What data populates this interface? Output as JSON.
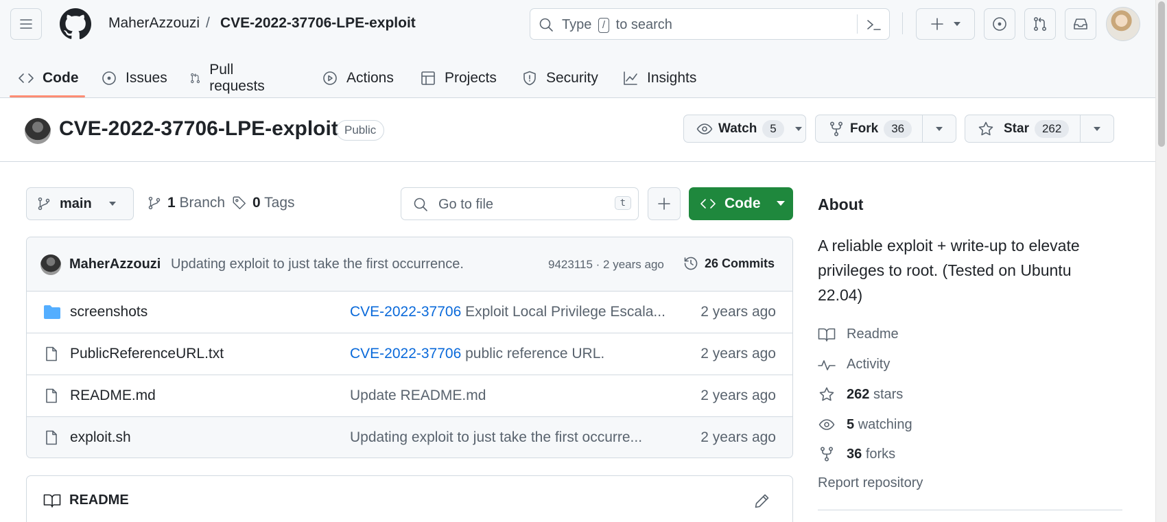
{
  "header": {
    "owner": "MaherAzzouzi",
    "separator": "/",
    "repo": "CVE-2022-37706-LPE-exploit",
    "search": {
      "prefix": "Type",
      "key": "/",
      "suffix": "to search"
    }
  },
  "tabs": [
    {
      "label": "Code",
      "icon": "code-icon",
      "active": true
    },
    {
      "label": "Issues",
      "icon": "issue-opened-icon"
    },
    {
      "label": "Pull requests",
      "icon": "git-pull-request-icon"
    },
    {
      "label": "Actions",
      "icon": "play-icon"
    },
    {
      "label": "Projects",
      "icon": "table-icon"
    },
    {
      "label": "Security",
      "icon": "shield-icon"
    },
    {
      "label": "Insights",
      "icon": "graph-icon"
    }
  ],
  "repo": {
    "name": "CVE-2022-37706-LPE-exploit",
    "visibility": "Public",
    "watch": {
      "label": "Watch",
      "count": "5"
    },
    "fork": {
      "label": "Fork",
      "count": "36"
    },
    "star": {
      "label": "Star",
      "count": "262"
    }
  },
  "toolbar": {
    "branch": "main",
    "branches_count": "1",
    "branches_label": "Branch",
    "tags_count": "0",
    "tags_label": "Tags",
    "goto_placeholder": "Go to file",
    "goto_key": "t",
    "code_label": "Code"
  },
  "latest_commit": {
    "author": "MaherAzzouzi",
    "message": "Updating exploit to just take the first occurrence.",
    "sha_age": "9423115 · 2 years ago",
    "commits_count": "26",
    "commits_label": "Commits"
  },
  "files": [
    {
      "name": "screenshots",
      "type": "dir",
      "msg_link": "CVE-2022-37706",
      "msg": " Exploit Local Privilege Escala...",
      "age": "2 years ago"
    },
    {
      "name": "PublicReferenceURL.txt",
      "type": "file",
      "msg_link": "CVE-2022-37706",
      "msg": " public reference URL.",
      "age": "2 years ago"
    },
    {
      "name": "README.md",
      "type": "file",
      "msg_link": "",
      "msg": "Update README.md",
      "age": "2 years ago"
    },
    {
      "name": "exploit.sh",
      "type": "file",
      "msg_link": "",
      "msg": "Updating exploit to just take the first occurre...",
      "age": "2 years ago"
    }
  ],
  "readme": {
    "title": "README"
  },
  "about": {
    "title": "About",
    "description": "A reliable exploit + write-up to elevate privileges to root. (Tested on Ubuntu 22.04)",
    "readme_label": "Readme",
    "activity_label": "Activity",
    "stars_count": "262",
    "stars_label": "stars",
    "watching_count": "5",
    "watching_label": "watching",
    "forks_count": "36",
    "forks_label": "forks",
    "report": "Report repository"
  },
  "colors": {
    "accent": "#0969da",
    "green": "#1f883d",
    "tab_underline": "#fd8c73",
    "dir_icon": "#54aeff"
  }
}
